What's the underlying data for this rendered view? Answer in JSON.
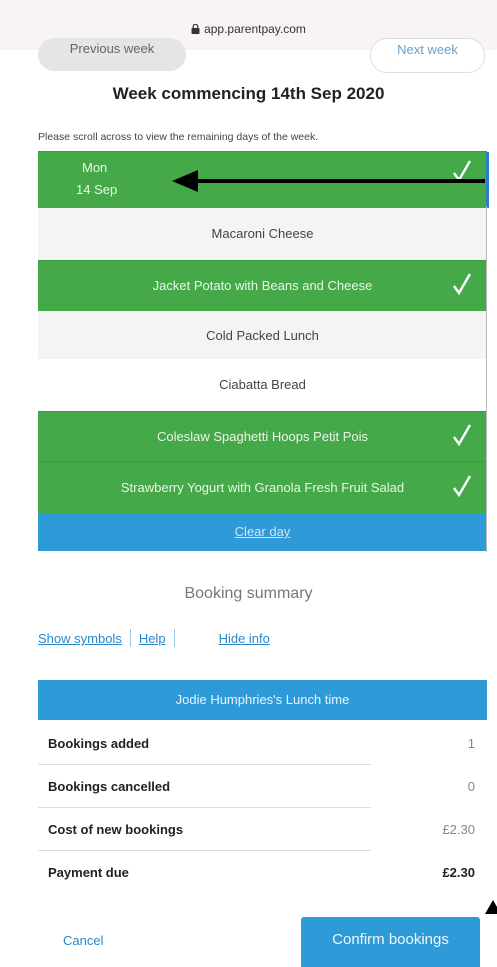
{
  "browser": {
    "url": "app.parentpay.com"
  },
  "nav": {
    "previous_label": "Previous week",
    "next_label": "Next week"
  },
  "week_title": "Week commencing 14th Sep 2020",
  "scroll_hint": "Please scroll across to view the remaining days of the week.",
  "day": {
    "name": "Mon",
    "date": "14 Sep",
    "selected": true,
    "options": [
      {
        "label": "Macaroni Cheese",
        "selected": false
      },
      {
        "label": "Jacket Potato with Beans and Cheese",
        "selected": true
      },
      {
        "label": "Cold Packed Lunch",
        "selected": false
      },
      {
        "label": "Ciabatta Bread",
        "selected": false
      },
      {
        "label": "Coleslaw Spaghetti Hoops Petit Pois",
        "selected": true
      },
      {
        "label": "Strawberry Yogurt with Granola Fresh Fruit Salad",
        "selected": true
      }
    ],
    "clear_label": "Clear day"
  },
  "summary": {
    "title": "Booking summary",
    "links": {
      "show_symbols": "Show symbols",
      "help": "Help",
      "hide_info": "Hide info"
    },
    "header": "Jodie Humphries's Lunch time",
    "rows": [
      {
        "label": "Bookings added",
        "value": "1"
      },
      {
        "label": "Bookings cancelled",
        "value": "0"
      },
      {
        "label": "Cost of new bookings",
        "value": "£2.30"
      },
      {
        "label": "Payment due",
        "value": "£2.30"
      }
    ]
  },
  "actions": {
    "cancel_label": "Cancel",
    "confirm_label": "Confirm bookings"
  },
  "colors": {
    "selected_green": "#45a849",
    "accent_blue": "#2f9ad8",
    "link_blue": "#2a88cc"
  }
}
